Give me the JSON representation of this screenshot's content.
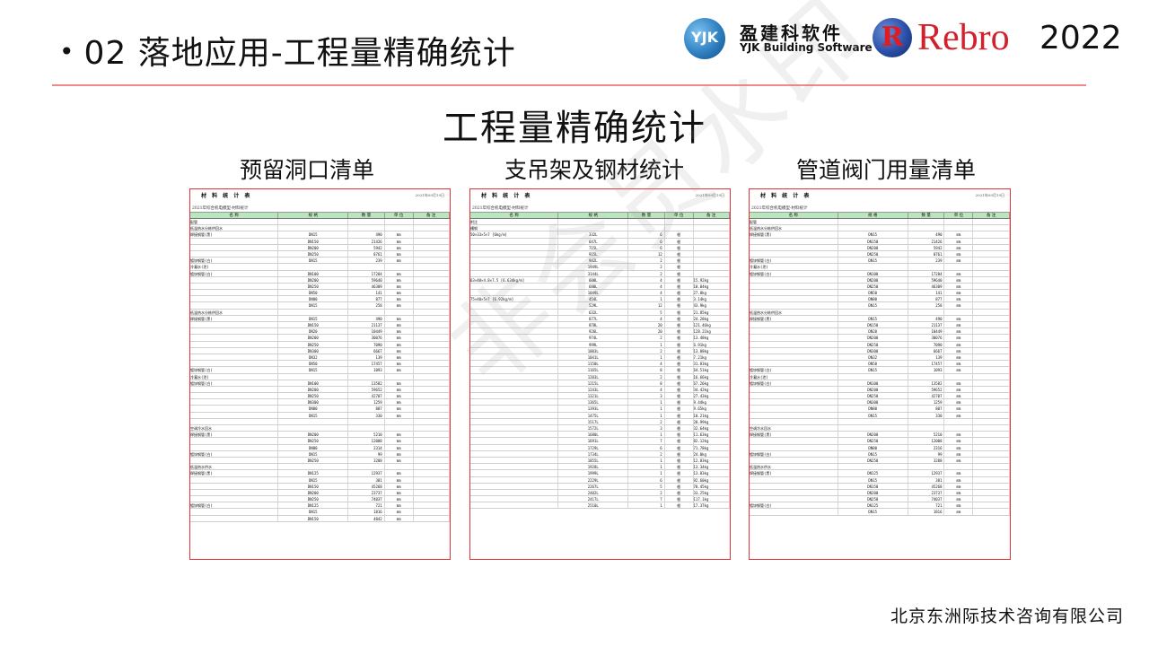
{
  "header": {
    "bullet": "•",
    "title": "02 落地应用-工程量精确统计"
  },
  "logos": {
    "yjk_mark": "YJK",
    "yjk_cn": "盈建科软件",
    "yjk_en": "YJK Building Software",
    "rebro_mark": "R",
    "rebro_word": "Rebro",
    "rebro_year": "2022"
  },
  "main": {
    "heading": "工程量精确统计",
    "panels": [
      {
        "title": "预留洞口清单"
      },
      {
        "title": "支吊架及钢材统计"
      },
      {
        "title": "管道阀门用量清单"
      }
    ]
  },
  "documents": [
    {
      "head_title": "材 料 统 计 表",
      "head_date": "2021年09月19日",
      "subtitle": "2021年综合机电模型-材料统计",
      "columns": [
        "名 称",
        "规 格",
        "数 量",
        "单 位",
        "备 注"
      ],
      "rows": [
        [
          "配管",
          "",
          "",
          "",
          ""
        ],
        [
          "低温热水分栋供回水",
          "",
          "",
          "",
          ""
        ],
        [
          "焊接钢管(黑)",
          "DN15",
          "490",
          "mm",
          ""
        ],
        [
          "",
          "DN150",
          "21426",
          "mm",
          ""
        ],
        [
          "",
          "DN200",
          "5942",
          "mm",
          ""
        ],
        [
          "",
          "DN250",
          "8761",
          "mm",
          ""
        ],
        [
          "镀锌钢管(白)",
          "DN15",
          "239",
          "mm",
          ""
        ],
        [
          "冷凝水(泄)",
          "",
          "",
          "",
          ""
        ],
        [
          "镀锌钢管(白)",
          "DN100",
          "17284",
          "mm",
          ""
        ],
        [
          "",
          "DN200",
          "59640",
          "mm",
          ""
        ],
        [
          "",
          "DN250",
          "46309",
          "mm",
          ""
        ],
        [
          "",
          "DN50",
          "141",
          "mm",
          ""
        ],
        [
          "",
          "DN80",
          "877",
          "mm",
          ""
        ],
        [
          "",
          "DN15",
          "258",
          "mm",
          ""
        ],
        [
          "低温热水分栋供回水",
          "",
          "",
          "",
          ""
        ],
        [
          "焊接钢管(黑)",
          "DN15",
          "490",
          "mm",
          ""
        ],
        [
          "",
          "DN150",
          "21137",
          "mm",
          ""
        ],
        [
          "",
          "DN20",
          "10449",
          "mm",
          ""
        ],
        [
          "",
          "DN200",
          "30076",
          "mm",
          ""
        ],
        [
          "",
          "DN250",
          "7090",
          "mm",
          ""
        ],
        [
          "",
          "DN300",
          "6667",
          "mm",
          ""
        ],
        [
          "",
          "DN32",
          "139",
          "mm",
          ""
        ],
        [
          "",
          "DN50",
          "17457",
          "mm",
          ""
        ],
        [
          "镀锌钢管(白)",
          "DN15",
          "1093",
          "mm",
          ""
        ],
        [
          "冷凝水(泄)",
          "",
          "",
          "",
          ""
        ],
        [
          "镀锌钢管(白)",
          "DN100",
          "13582",
          "mm",
          ""
        ],
        [
          "",
          "DN200",
          "59652",
          "mm",
          ""
        ],
        [
          "",
          "DN250",
          "42707",
          "mm",
          ""
        ],
        [
          "",
          "DN300",
          "1259",
          "mm",
          ""
        ],
        [
          "",
          "DN80",
          "807",
          "mm",
          ""
        ],
        [
          "",
          "DN15",
          "330",
          "mm",
          ""
        ],
        [
          "",
          "",
          "",
          "",
          ""
        ],
        [
          "空调冷水回水",
          "",
          "",
          "",
          ""
        ],
        [
          "焊接钢管(黑)",
          "DN200",
          "5210",
          "mm",
          ""
        ],
        [
          "",
          "DN250",
          "12008",
          "mm",
          ""
        ],
        [
          "",
          "DN80",
          "2314",
          "mm",
          ""
        ],
        [
          "镀锌钢管(白)",
          "DN15",
          "99",
          "mm",
          ""
        ],
        [
          "",
          "DN250",
          "3288",
          "mm",
          ""
        ],
        [
          "低温热水供水",
          "",
          "",
          "",
          ""
        ],
        [
          "焊接钢管(黑)",
          "DN125",
          "12937",
          "mm",
          ""
        ],
        [
          "",
          "DN15",
          "381",
          "mm",
          ""
        ],
        [
          "",
          "DN150",
          "45268",
          "mm",
          ""
        ],
        [
          "",
          "DN200",
          "23737",
          "mm",
          ""
        ],
        [
          "",
          "DN250",
          "74037",
          "mm",
          ""
        ],
        [
          "镀锌钢管(白)",
          "DN125",
          "721",
          "mm",
          ""
        ],
        [
          "",
          "DN15",
          "1816",
          "mm",
          ""
        ],
        [
          "",
          "DN150",
          "4842",
          "mm",
          ""
        ]
      ]
    },
    {
      "head_title": "材 料 统 计 表",
      "head_date": "2021年09月19日",
      "subtitle": "2021年综合机电模型-材料统计",
      "columns": [
        "名 称",
        "规 格",
        "数 量",
        "单 位",
        "备 注"
      ],
      "rows": [
        [
          "附注",
          "",
          "",
          "",
          ""
        ],
        [
          "槽钢",
          "",
          "",
          "",
          ""
        ],
        [
          "50×33×5×7 [6kg/m]",
          "332L",
          "6",
          "根",
          ""
        ],
        [
          "",
          "647L",
          "6",
          "根",
          ""
        ],
        [
          "",
          "715L",
          "6",
          "根",
          ""
        ],
        [
          "",
          "915L",
          "12",
          "根",
          ""
        ],
        [
          "",
          "942L",
          "2",
          "根",
          ""
        ],
        [
          "",
          "1949L",
          "2",
          "根",
          ""
        ],
        [
          "",
          "3144L",
          "2",
          "根",
          ""
        ],
        [
          "63×40×4.8×7.5 [6.634kg/m]",
          "600L",
          "4",
          "根",
          "15.92kg"
        ],
        [
          "",
          "680L",
          "4",
          "根",
          "18.04kg"
        ],
        [
          "",
          "1049L",
          "4",
          "根",
          "27.8kg"
        ],
        [
          "75×40×5×7 [6.92kg/m]",
          "454L",
          "1",
          "根",
          "3.14kg"
        ],
        [
          "",
          "529L",
          "12",
          "根",
          "43.9kg"
        ],
        [
          "",
          "632L",
          "5",
          "根",
          "21.85kg"
        ],
        [
          "",
          "877L",
          "4",
          "根",
          "24.28kg"
        ],
        [
          "",
          "878L",
          "20",
          "根",
          "121.46kg"
        ],
        [
          "",
          "926L",
          "20",
          "根",
          "128.21kg"
        ],
        [
          "",
          "974L",
          "2",
          "根",
          "13.48kg"
        ],
        [
          "",
          "999L",
          "1",
          "根",
          "6.91kg"
        ],
        [
          "",
          "1003L",
          "2",
          "根",
          "13.88kg"
        ],
        [
          "",
          "1041L",
          "1",
          "根",
          "7.21kg"
        ],
        [
          "",
          "1150L",
          "4",
          "根",
          "31.83kg"
        ],
        [
          "",
          "1165L",
          "8",
          "根",
          "64.51kg"
        ],
        [
          "",
          "1203L",
          "2",
          "根",
          "16.66kg"
        ],
        [
          "",
          "1215L",
          "8",
          "根",
          "67.26kg"
        ],
        [
          "",
          "1243L",
          "4",
          "根",
          "34.42kg"
        ],
        [
          "",
          "1321L",
          "3",
          "根",
          "27.43kg"
        ],
        [
          "",
          "1365L",
          "1",
          "根",
          "9.44kg"
        ],
        [
          "",
          "1393L",
          "1",
          "根",
          "9.65kg"
        ],
        [
          "",
          "1475L",
          "1",
          "根",
          "10.21kg"
        ],
        [
          "",
          "1517L",
          "2",
          "根",
          "20.99kg"
        ],
        [
          "",
          "1572L",
          "3",
          "根",
          "32.64kg"
        ],
        [
          "",
          "1680L",
          "1",
          "根",
          "11.63kg"
        ],
        [
          "",
          "1691L",
          "7",
          "根",
          "82.12kg"
        ],
        [
          "",
          "1729L",
          "6",
          "根",
          "71.78kg"
        ],
        [
          "",
          "1734L",
          "2",
          "根",
          "24.0kg"
        ],
        [
          "",
          "1855L",
          "1",
          "根",
          "12.83kg"
        ],
        [
          "",
          "1928L",
          "1",
          "根",
          "13.34kg"
        ],
        [
          "",
          "1999L",
          "1",
          "根",
          "13.83kg"
        ],
        [
          "",
          "2229L",
          "6",
          "根",
          "92.60kg"
        ],
        [
          "",
          "2267L",
          "5",
          "根",
          "78.45kg"
        ],
        [
          "",
          "2402L",
          "2",
          "根",
          "33.25kg"
        ],
        [
          "",
          "2417L",
          "7",
          "根",
          "117.1kg"
        ],
        [
          "",
          "2510L",
          "1",
          "根",
          "17.37kg"
        ]
      ]
    },
    {
      "head_title": "材 料 统 计 表",
      "head_date": "2021年09月19日",
      "subtitle": "2021年综合机电模型-材料统计",
      "columns": [
        "名 称",
        "规 格",
        "数 量",
        "单 位",
        "备 注"
      ],
      "rows": [
        [
          "配管",
          "",
          "",
          "",
          ""
        ],
        [
          "低温热水分栋供回水",
          "",
          "",
          "",
          ""
        ],
        [
          "焊接钢管(黑)",
          "DN15",
          "490",
          "mm",
          ""
        ],
        [
          "",
          "DN150",
          "21426",
          "mm",
          ""
        ],
        [
          "",
          "DN200",
          "5942",
          "mm",
          ""
        ],
        [
          "",
          "DN250",
          "8761",
          "mm",
          ""
        ],
        [
          "镀锌钢管(白)",
          "DN15",
          "239",
          "mm",
          ""
        ],
        [
          "冷凝水(泄)",
          "",
          "",
          "",
          ""
        ],
        [
          "镀锌钢管(白)",
          "DN100",
          "17284",
          "mm",
          ""
        ],
        [
          "",
          "DN200",
          "59640",
          "mm",
          ""
        ],
        [
          "",
          "DN250",
          "46309",
          "mm",
          ""
        ],
        [
          "",
          "DN50",
          "141",
          "mm",
          ""
        ],
        [
          "",
          "DN80",
          "877",
          "mm",
          ""
        ],
        [
          "",
          "DN15",
          "258",
          "mm",
          ""
        ],
        [
          "低温热水分栋供回水",
          "",
          "",
          "",
          ""
        ],
        [
          "焊接钢管(黑)",
          "DN15",
          "490",
          "mm",
          ""
        ],
        [
          "",
          "DN150",
          "21137",
          "mm",
          ""
        ],
        [
          "",
          "DN20",
          "10449",
          "mm",
          ""
        ],
        [
          "",
          "DN200",
          "30076",
          "mm",
          ""
        ],
        [
          "",
          "DN250",
          "7090",
          "mm",
          ""
        ],
        [
          "",
          "DN300",
          "6667",
          "mm",
          ""
        ],
        [
          "",
          "DN32",
          "139",
          "mm",
          ""
        ],
        [
          "",
          "DN50",
          "17457",
          "mm",
          ""
        ],
        [
          "镀锌钢管(白)",
          "DN15",
          "1093",
          "mm",
          ""
        ],
        [
          "冷凝水(泄)",
          "",
          "",
          "",
          ""
        ],
        [
          "镀锌钢管(白)",
          "DN100",
          "13582",
          "mm",
          ""
        ],
        [
          "",
          "DN200",
          "59652",
          "mm",
          ""
        ],
        [
          "",
          "DN250",
          "42707",
          "mm",
          ""
        ],
        [
          "",
          "DN300",
          "1259",
          "mm",
          ""
        ],
        [
          "",
          "DN80",
          "807",
          "mm",
          ""
        ],
        [
          "",
          "DN15",
          "330",
          "mm",
          ""
        ],
        [
          "",
          "",
          "",
          "",
          ""
        ],
        [
          "空调冷水回水",
          "",
          "",
          "",
          ""
        ],
        [
          "焊接钢管(黑)",
          "DN200",
          "5210",
          "mm",
          ""
        ],
        [
          "",
          "DN250",
          "12008",
          "mm",
          ""
        ],
        [
          "",
          "DN80",
          "2316",
          "mm",
          ""
        ],
        [
          "镀锌钢管(白)",
          "DN15",
          "99",
          "mm",
          ""
        ],
        [
          "",
          "DN250",
          "3288",
          "mm",
          ""
        ],
        [
          "低温热水供水",
          "",
          "",
          "",
          ""
        ],
        [
          "焊接钢管(黑)",
          "DN125",
          "12937",
          "mm",
          ""
        ],
        [
          "",
          "DN15",
          "381",
          "mm",
          ""
        ],
        [
          "",
          "DN150",
          "45268",
          "mm",
          ""
        ],
        [
          "",
          "DN200",
          "23737",
          "mm",
          ""
        ],
        [
          "",
          "DN250",
          "74037",
          "mm",
          ""
        ],
        [
          "镀锌钢管(白)",
          "DN125",
          "721",
          "mm",
          ""
        ],
        [
          "",
          "DN15",
          "1816",
          "mm",
          ""
        ]
      ]
    }
  ],
  "watermark": "非会员水印",
  "footer": {
    "company": "北京东洲际技术咨询有限公司"
  }
}
